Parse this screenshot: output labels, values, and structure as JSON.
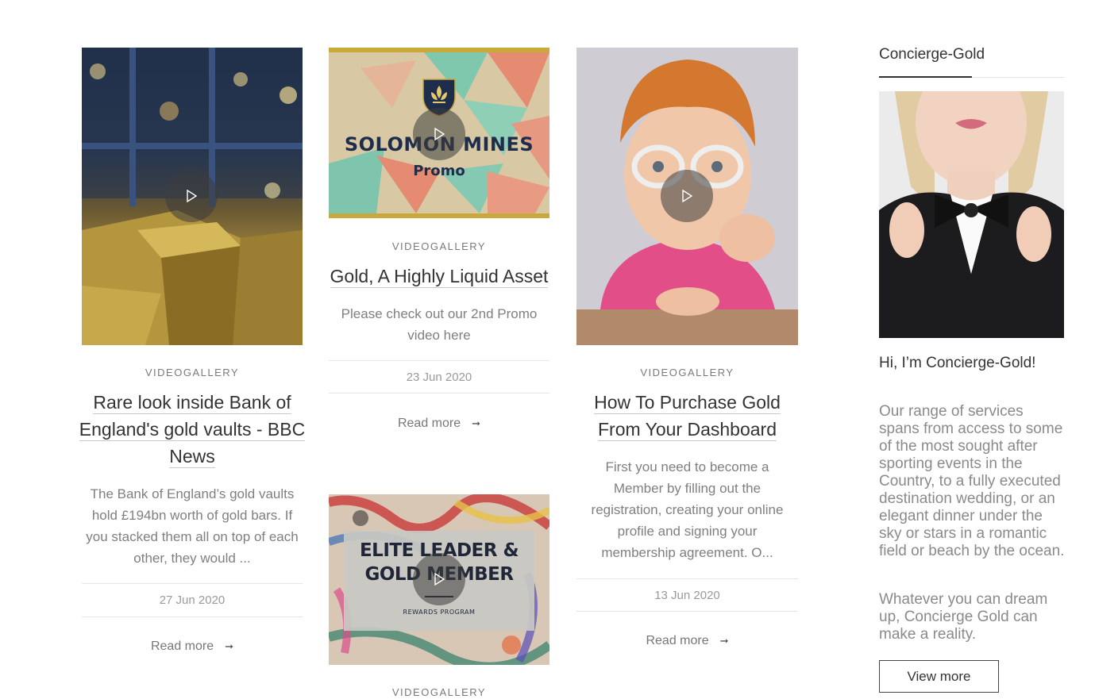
{
  "posts": [
    {
      "category": "VIDEOGALLERY",
      "title": "Rare look inside Bank of England's gold vaults - BBC News",
      "title_lines": [
        "Rare look inside Bank of",
        "England's gold vaults - BBC",
        "News"
      ],
      "excerpt": "The Bank of England’s gold vaults hold £194bn worth of gold bars. If you stacked them all on top of each other, they would ...",
      "date": "27 Jun 2020",
      "read_more": "Read more"
    },
    {
      "thumb_text": {
        "line1": "SOLOMON MINES",
        "line2": "Promo"
      },
      "category": "VIDEOGALLERY",
      "title": "Gold, A Highly Liquid Asset",
      "title_lines": [
        "Gold, A Highly Liquid Asset"
      ],
      "excerpt": "Please check out our 2nd Promo video here",
      "date": "23 Jun 2020",
      "read_more": "Read more"
    },
    {
      "category": "VIDEOGALLERY",
      "title": "How To Purchase Gold From Your Dashboard",
      "title_lines": [
        "How To Purchase Gold",
        "From Your Dashboard"
      ],
      "excerpt": "First you need to become a Member by filling out the registration, creating your online profile and signing your membership agreement.  O...",
      "date": "13 Jun 2020",
      "read_more": "Read more"
    },
    {
      "thumb_text": {
        "line1": "ELITE LEADER &",
        "line2": "GOLD MEMBER",
        "line3": "REWARDS PROGRAM"
      },
      "category": "VIDEOGALLERY"
    }
  ],
  "sidebar": {
    "title": "Concierge-Gold",
    "greeting": "Hi, I’m Concierge-Gold!",
    "paragraph1": "Our range of services spans from access to some of the most sought after sporting events in the Country, to a fully executed destination wedding, or an elegant dinner under the sky or stars in a romantic field or beach by the ocean.",
    "paragraph2": "Whatever you can dream up, Concierge Gold can make a reality.",
    "button": "View more"
  },
  "colors": {
    "text": "#333333",
    "muted": "#7f7f7f",
    "gold": "#c9a93a",
    "navy": "#1f2d4d"
  },
  "icons": [
    "play-icon",
    "arrow-right-icon",
    "fleur-de-lis-icon"
  ]
}
